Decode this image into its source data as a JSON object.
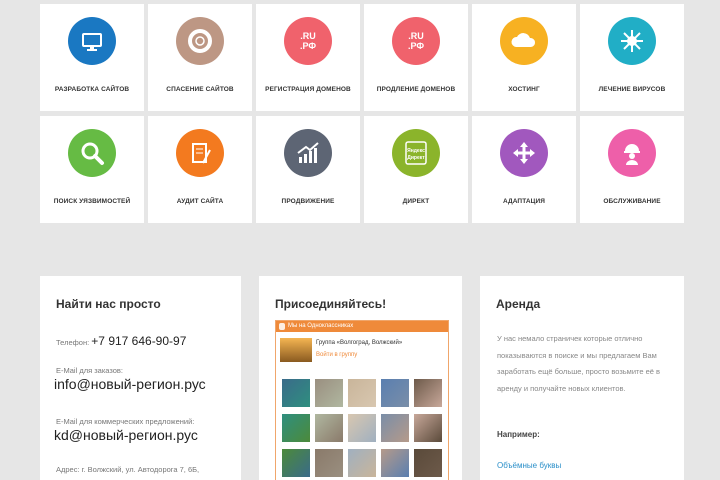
{
  "services": [
    {
      "label": "разработка сайтов",
      "color": "#1a78c2",
      "icon": "monitor-icon"
    },
    {
      "label": "спасение сайтов",
      "color": "#bd9784",
      "icon": "lifebuoy-icon"
    },
    {
      "label": "регистрация доменов",
      "color": "#f0626c",
      "icon": "domain-ru-rf-icon",
      "badge": [
        ".RU",
        ".РФ"
      ]
    },
    {
      "label": "продление доменов",
      "color": "#f0626c",
      "icon": "domain-ru-rf-icon",
      "badge": [
        ".RU",
        ".РФ"
      ]
    },
    {
      "label": "хостинг",
      "color": "#f7b122",
      "icon": "cloud-icon"
    },
    {
      "label": "лечение вирусов",
      "color": "#21aec6",
      "icon": "virus-icon"
    },
    {
      "label": "поиск уязвимостей",
      "color": "#66bb44",
      "icon": "magnifier-icon"
    },
    {
      "label": "аудит сайта",
      "color": "#f37a1f",
      "icon": "document-pen-icon"
    },
    {
      "label": "продвижение",
      "color": "#5d6574",
      "icon": "growth-chart-icon"
    },
    {
      "label": "директ",
      "color": "#8bb42b",
      "icon": "yandex-direct-icon",
      "badge": [
        "Яндекс",
        "Директ"
      ]
    },
    {
      "label": "адаптация",
      "color": "#a158be",
      "icon": "move-arrows-icon"
    },
    {
      "label": "обслуживание",
      "color": "#ee5fa9",
      "icon": "worker-icon"
    }
  ],
  "contacts": {
    "title": "Найти нас просто",
    "phone_label": "Телефон:",
    "phone": "+7 917 646-90-97",
    "email_orders_label": "E-Mail для заказов:",
    "email_orders": "info@новый-регион.рус",
    "email_commercial_label": "E-Mail для коммерческих предложений:",
    "email_commercial": "kd@новый-регион.рус",
    "address": "Адрес: г. Волжский, ул. Автодорога 7, 6Б,"
  },
  "social": {
    "title": "Присоединяйтесь!",
    "widget_header": "Мы на Одноклассниках",
    "group_name": "Группа «Волгоград, Волжский»",
    "join_label": "Войти в группу"
  },
  "rent": {
    "title": "Аренда",
    "text": "У нас немало страничек которые отлично показываются в поиске и мы предлагаем Вам заработать ещё больше, просто возьмите её в аренду и получайте новых клиентов.",
    "example_label": "Например:",
    "link": "Объёмные буквы"
  }
}
